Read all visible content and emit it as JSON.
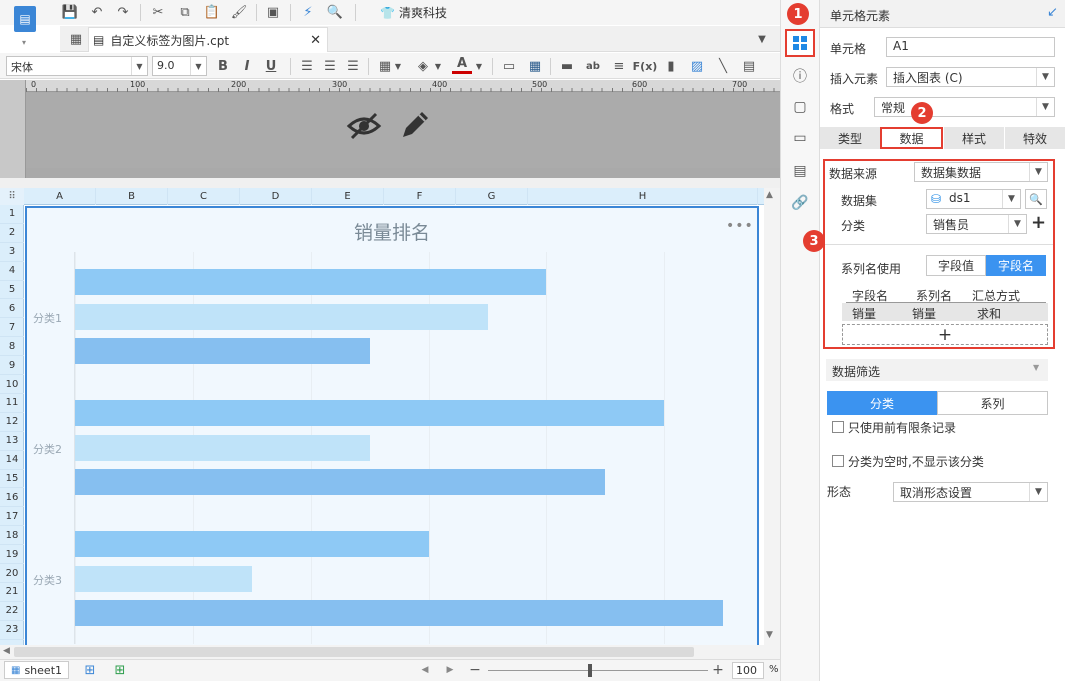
{
  "toolbar": {
    "company_label": "清爽科技",
    "tab_filename": "自定义标签为图片.cpt",
    "font_name": "宋体",
    "font_size": "9.0"
  },
  "ruler": {
    "ticks": [
      "0",
      "100",
      "200",
      "300",
      "400",
      "500",
      "600",
      "700"
    ]
  },
  "sheet": {
    "columns": [
      "A",
      "B",
      "C",
      "D",
      "E",
      "F",
      "G",
      "H"
    ],
    "rows": [
      "1",
      "2",
      "3",
      "4",
      "5",
      "6",
      "7",
      "8",
      "9",
      "10",
      "11",
      "12",
      "13",
      "14",
      "15",
      "16",
      "17",
      "18",
      "19",
      "20",
      "21",
      "22",
      "23"
    ]
  },
  "chart_data": {
    "type": "bar",
    "orientation": "horizontal",
    "title": "销量排名",
    "categories": [
      "分类1",
      "分类2",
      "分类3"
    ],
    "series": [
      {
        "values": [
          80,
          100,
          60
        ],
        "color": "#8ec9f5"
      },
      {
        "values": [
          70,
          50,
          30
        ],
        "color": "#bfe3f9"
      },
      {
        "values": [
          50,
          90,
          110
        ],
        "color": "#86bff0"
      }
    ],
    "xlim": [
      0,
      112
    ],
    "grid": true
  },
  "bottom": {
    "sheet_tab": "sheet1",
    "zoom": "100",
    "zoom_unit": "%"
  },
  "panel": {
    "header": "单元格元素",
    "cell_label": "单元格",
    "cell_value": "A1",
    "insert_label": "插入元素",
    "insert_value": "插入图表 (C)",
    "format_label": "格式",
    "format_value": "常规",
    "tabs": [
      "类型",
      "数据",
      "样式",
      "特效"
    ],
    "datasource_label": "数据来源",
    "datasource_value": "数据集数据",
    "dataset_label": "数据集",
    "dataset_value": "ds1",
    "category_label": "分类",
    "category_value": "销售员",
    "series_name_label": "系列名使用",
    "series_opt_value": "字段值",
    "series_opt_name": "字段名",
    "table_headers": [
      "字段名",
      "系列名",
      "汇总方式"
    ],
    "table_row": [
      "销量",
      "销量",
      "求和"
    ],
    "add_symbol": "+",
    "filter_label": "数据筛选",
    "filter_tab_cat": "分类",
    "filter_tab_series": "系列",
    "limit_label": "只使用前有限条记录",
    "empty_label": "分类为空时,不显示该分类",
    "shape_label": "形态",
    "shape_value": "取消形态设置"
  },
  "badges": [
    "1",
    "2",
    "3"
  ]
}
